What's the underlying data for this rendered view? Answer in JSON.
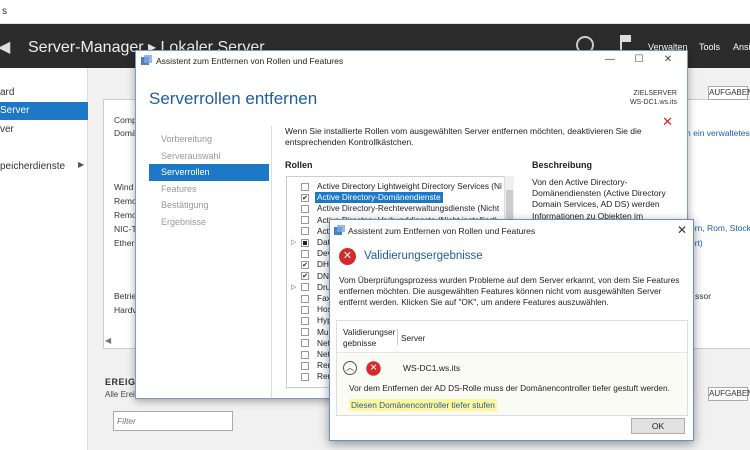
{
  "server_manager": {
    "window_title": "",
    "header_title": "Server-Manager ▸ Lokaler Server",
    "menu": [
      "Verwalten",
      "Tools",
      "Ansicht"
    ],
    "nav_items": [
      "ard",
      "Server",
      "ver",
      "peicherdienste"
    ],
    "panel_labels": [
      "Comp",
      "Domä",
      "Wind",
      "Remo",
      "Remo",
      "NIC-T",
      "Ether",
      "Betrie",
      "Hardv"
    ],
    "right_links": [
      "n ein verwaltetes",
      "ern, Rom, Stockholm",
      "ert)",
      "ssor"
    ],
    "aufgaben": "AUFGABEN",
    "events_title": "EREIG",
    "events_sub": "Alle Erei",
    "filter_placeholder": "Filter"
  },
  "wizard": {
    "title": "Assistent zum Entfernen von Rollen und Features",
    "heading": "Serverrollen entfernen",
    "target_label": "ZIELSERVER",
    "target_server": "WS-DC1.ws.its",
    "steps": [
      "Vorbereitung",
      "Serverauswahl",
      "Serverrollen",
      "Features",
      "Bestätigung",
      "Ergebnisse"
    ],
    "selected_step": 2,
    "intro": "Wenn Sie installierte Rollen vom ausgewählten Server entfernen möchten, deaktivieren Sie die entsprechenden Kontrollkästchen.",
    "roles_heading": "Rollen",
    "description_heading": "Beschreibung",
    "description": "Von den Active Directory-Domänendiensten (Active Directory Domain Services, AD DS) werden Informationen zu Objekten im",
    "roles": [
      {
        "label": "Active Directory Lightweight Directory Services (Ni",
        "state": "none"
      },
      {
        "label": "Active Directory-Domänendienste",
        "state": "checked",
        "highlight": true
      },
      {
        "label": "Active Directory-Rechteverwaltungsdienste (Nicht",
        "state": "none"
      },
      {
        "label": "Active Directory-Verbunddienste (Nicht installiert)",
        "state": "none"
      },
      {
        "label": "Activ",
        "state": "none"
      },
      {
        "label": "Dat",
        "state": "partial",
        "expander": true
      },
      {
        "label": "Dev",
        "state": "none"
      },
      {
        "label": "DHC",
        "state": "checked"
      },
      {
        "label": "DNS",
        "state": "checked"
      },
      {
        "label": "Dru",
        "state": "none",
        "expander": true
      },
      {
        "label": "Fax",
        "state": "none"
      },
      {
        "label": "Hos",
        "state": "none"
      },
      {
        "label": "Hyp",
        "state": "none"
      },
      {
        "label": "Mul",
        "state": "none"
      },
      {
        "label": "Net",
        "state": "none"
      },
      {
        "label": "Net",
        "state": "none"
      },
      {
        "label": "Rem",
        "state": "none"
      },
      {
        "label": "Rem",
        "state": "none"
      }
    ]
  },
  "validation": {
    "title": "Assistent zum Entfernen von Rollen und Features",
    "heading": "Validierungsergebnisse",
    "message": "Vom Überprüfungsprozess wurden Probleme auf dem Server erkannt, von dem Sie Features entfernen möchten. Die ausgewählten Features können nicht vom ausgewählten Server entfernt werden. Klicken Sie auf \"OK\", um andere Features auszuwählen.",
    "col1": "Validierungser gebnisse",
    "col2": "Server",
    "row_server": "WS-DC1.ws.its",
    "row_description": "Vor dem Entfernen der AD DS-Rolle muss der Domänencontroller tiefer gestuft werden.",
    "row_link": "Diesen Domänencontroller tiefer stufen",
    "ok": "OK"
  },
  "colors": {
    "accent": "#1e78c8",
    "heading": "#1e5e9e",
    "error": "#d42a2a",
    "highlight": "#fff79a"
  }
}
